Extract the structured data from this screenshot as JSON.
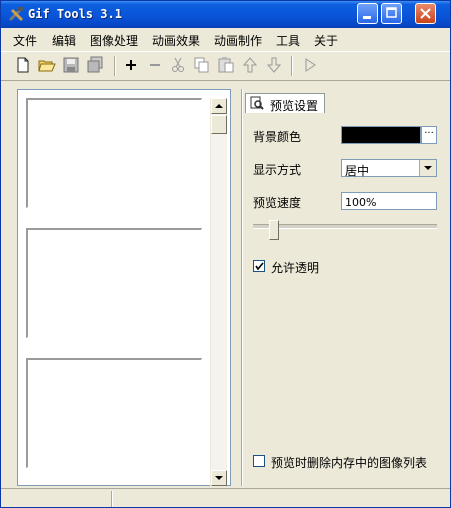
{
  "window": {
    "title": "Gif Tools 3.1"
  },
  "menu": [
    "文件",
    "编辑",
    "图像处理",
    "动画效果",
    "动画制作",
    "工具",
    "关于"
  ],
  "toolbar": [
    "new-icon",
    "open-icon",
    "save-icon",
    "save-all-icon",
    "add-icon",
    "remove-icon",
    "cut-icon",
    "copy-icon",
    "paste-icon",
    "move-up-icon",
    "move-down-icon",
    "play-icon"
  ],
  "settings": {
    "tab_label": "预览设置",
    "bg_color_label": "背景颜色",
    "bg_color_value": "#000000",
    "bg_color_button": "···",
    "display_label": "显示方式",
    "display_value": "居中",
    "speed_label": "预览速度",
    "speed_value": "100%",
    "allow_transparent_label": "允许透明",
    "allow_transparent_checked": true,
    "delete_on_preview_label": "预览时删除内存中的图像列表",
    "delete_on_preview_checked": false
  }
}
